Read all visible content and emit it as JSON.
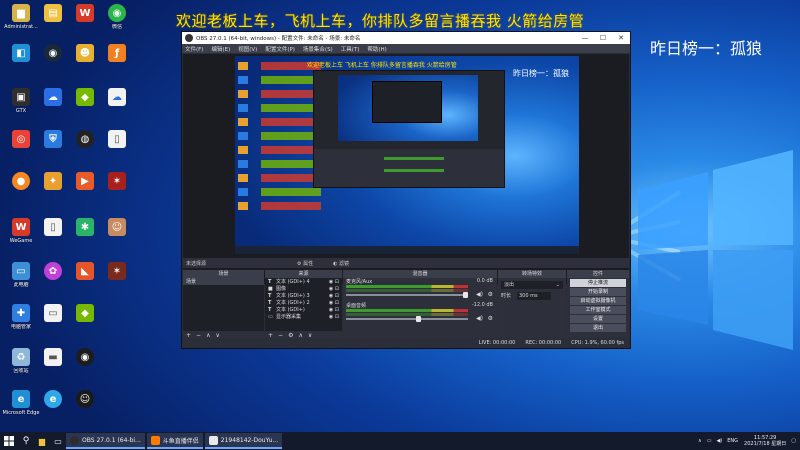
{
  "overlay": {
    "main_text": "欢迎老板上车，飞机上车，你排队多留言播吞我 火箭给房管",
    "side_text": "昨日榜一：孤狼",
    "preview_main_text": "欢迎老板上车 飞机上车 你排队多留言播吞我 火箭给房管",
    "preview_side_text": "昨日榜一：孤狼"
  },
  "desktop_icons": [
    {
      "label": "Administrat...",
      "icon": "user-folder-icon",
      "color": "#d8b34a",
      "glyph": "▆"
    },
    {
      "label": "Microsoft Edge",
      "icon": "edge-icon",
      "color": "#1f8fd6",
      "glyph": "e"
    },
    {
      "label": "此电脑",
      "icon": "computer-icon",
      "color": "#3d8fd8",
      "glyph": "▭"
    },
    {
      "label": "回收站",
      "icon": "recycle-bin-icon",
      "color": "#8fb8d8",
      "glyph": "♻"
    },
    {
      "label": "WeGame",
      "icon": "wegame-icon",
      "color": "#d83a2a",
      "glyph": "W"
    },
    {
      "label": "电脑管家",
      "icon": "guard-icon",
      "color": "#2f7fe0",
      "glyph": "✚"
    },
    {
      "label": "GTX",
      "icon": "gpu-icon",
      "color": "#2e2e2e",
      "glyph": "▣"
    },
    {
      "label": "微信",
      "icon": "wechat-icon",
      "color": "#2bb64a",
      "glyph": "◉"
    }
  ],
  "obs": {
    "title": "OBS 27.0.1 (64-bit, windows) - 配置文件: 未命名 - 场景: 未命名",
    "menu": [
      "文件(F)",
      "编辑(E)",
      "视图(V)",
      "配置文件(P)",
      "场景集合(S)",
      "工具(T)",
      "帮助(H)"
    ],
    "no_source_selected": "未选择源",
    "properties_label": "属性",
    "filters_label": "滤镜",
    "panels": {
      "scenes": "场景",
      "sources": "来源",
      "mixer": "混音器",
      "transitions": "转场特效",
      "controls": "控件"
    },
    "scene_items": [
      "场景"
    ],
    "source_items": [
      {
        "type": "T",
        "label": "文本 (GDI+) 4"
      },
      {
        "type": "■",
        "label": "图像"
      },
      {
        "type": "T",
        "label": "文本 (GDI+) 3"
      },
      {
        "type": "T",
        "label": "文本 (GDI+) 2"
      },
      {
        "type": "T",
        "label": "文本 (GDI+)"
      },
      {
        "type": "▭",
        "label": "显示器采集"
      }
    ],
    "mixer_channels": [
      {
        "name": "麦克风/Aux",
        "db": "0.0 dB"
      },
      {
        "name": "桌面音频",
        "db": "-12.0 dB"
      }
    ],
    "transition": {
      "type": "淡出",
      "duration_label": "时长",
      "duration": "300 ms"
    },
    "controls": [
      "停止推流",
      "开始录制",
      "启动虚拟摄像机",
      "工作室模式",
      "设置",
      "退出"
    ],
    "status": {
      "live": "LIVE: 00:00:00",
      "rec": "REC: 00:00:00",
      "cpu": "CPU: 1.9%, 60.00 fps"
    }
  },
  "taskbar": {
    "tasks": [
      {
        "label": "OBS 27.0.1 (64-bi...",
        "color": "#2d2d2d"
      },
      {
        "label": "斗鱼直播伴侣",
        "color": "#ff7a00"
      },
      {
        "label": "21948142-DouYu...",
        "color": "#e8e8e8"
      }
    ],
    "tray": {
      "lang": "ENG",
      "time": "11:57:29",
      "date": "2021/7/18 星期日"
    }
  }
}
